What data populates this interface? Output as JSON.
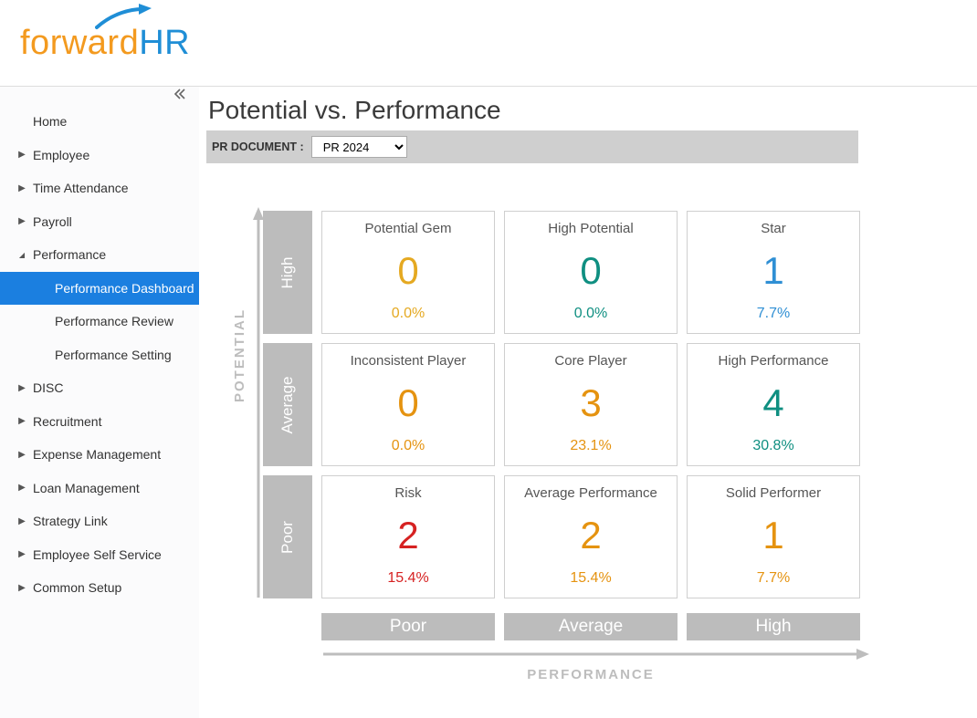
{
  "logo": {
    "part1": "forward",
    "part2": "HR"
  },
  "sidebar": {
    "items": [
      {
        "label": "Home",
        "expandable": false,
        "expanded": false
      },
      {
        "label": "Employee",
        "expandable": true,
        "expanded": false
      },
      {
        "label": "Time Attendance",
        "expandable": true,
        "expanded": false
      },
      {
        "label": "Payroll",
        "expandable": true,
        "expanded": false
      },
      {
        "label": "Performance",
        "expandable": true,
        "expanded": true,
        "children": [
          {
            "label": "Performance Dashboard",
            "active": true
          },
          {
            "label": "Performance Review",
            "active": false
          },
          {
            "label": "Performance Setting",
            "active": false
          }
        ]
      },
      {
        "label": "DISC",
        "expandable": true,
        "expanded": false
      },
      {
        "label": "Recruitment",
        "expandable": true,
        "expanded": false
      },
      {
        "label": "Expense Management",
        "expandable": true,
        "expanded": false
      },
      {
        "label": "Loan Management",
        "expandable": true,
        "expanded": false
      },
      {
        "label": "Strategy Link",
        "expandable": true,
        "expanded": false
      },
      {
        "label": "Employee Self Service",
        "expandable": true,
        "expanded": false
      },
      {
        "label": "Common Setup",
        "expandable": true,
        "expanded": false
      }
    ]
  },
  "page": {
    "title": "Potential vs. Performance"
  },
  "filter": {
    "label": "PR DOCUMENT :",
    "selected": "PR 2024"
  },
  "axes": {
    "y_label": "POTENTIAL",
    "x_label": "PERFORMANCE",
    "y_categories": [
      "High",
      "Average",
      "Poor"
    ],
    "x_categories": [
      "Poor",
      "Average",
      "High"
    ]
  },
  "colors": {
    "gold": "#e5a921",
    "teal": "#0f8f81",
    "blue": "#2f8fd4",
    "orange": "#e59310",
    "red": "#d62222"
  },
  "cells": [
    {
      "title": "Potential Gem",
      "count": 0,
      "pct": "0.0%",
      "color": "gold"
    },
    {
      "title": "High Potential",
      "count": 0,
      "pct": "0.0%",
      "color": "teal"
    },
    {
      "title": "Star",
      "count": 1,
      "pct": "7.7%",
      "color": "blue"
    },
    {
      "title": "Inconsistent Player",
      "count": 0,
      "pct": "0.0%",
      "color": "orange"
    },
    {
      "title": "Core Player",
      "count": 3,
      "pct": "23.1%",
      "color": "orange"
    },
    {
      "title": "High Performance",
      "count": 4,
      "pct": "30.8%",
      "color": "teal"
    },
    {
      "title": "Risk",
      "count": 2,
      "pct": "15.4%",
      "color": "red"
    },
    {
      "title": "Average Performance",
      "count": 2,
      "pct": "15.4%",
      "color": "orange"
    },
    {
      "title": "Solid Performer",
      "count": 1,
      "pct": "7.7%",
      "color": "orange"
    }
  ],
  "chart_data": {
    "type": "heatmap",
    "title": "Potential vs. Performance",
    "xlabel": "PERFORMANCE",
    "ylabel": "POTENTIAL",
    "x_categories": [
      "Poor",
      "Average",
      "High"
    ],
    "y_categories": [
      "High",
      "Average",
      "Poor"
    ],
    "series": [
      {
        "name": "count",
        "values": [
          [
            0,
            0,
            1
          ],
          [
            0,
            3,
            4
          ],
          [
            2,
            2,
            1
          ]
        ]
      },
      {
        "name": "percent",
        "values": [
          [
            0.0,
            0.0,
            7.7
          ],
          [
            0.0,
            23.1,
            30.8
          ],
          [
            15.4,
            15.4,
            7.7
          ]
        ]
      }
    ],
    "cell_labels": [
      [
        "Potential Gem",
        "High Potential",
        "Star"
      ],
      [
        "Inconsistent Player",
        "Core Player",
        "High Performance"
      ],
      [
        "Risk",
        "Average Performance",
        "Solid Performer"
      ]
    ]
  }
}
